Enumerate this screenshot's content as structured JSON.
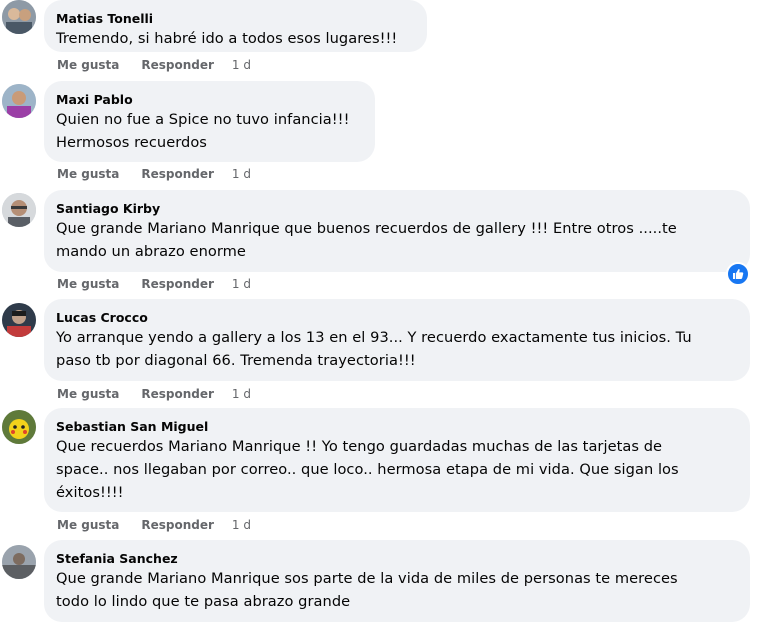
{
  "comments": [
    {
      "author": "Matias Tonelli",
      "text": "Tremendo, si habré ido a todos esos lugares!!!",
      "like": "Me gusta",
      "reply": "Responder",
      "time": "1 d"
    },
    {
      "author": "Maxi Pablo",
      "text": "Quien no fue a Spice no tuvo infancia!!!\nHermosos recuerdos",
      "like": "Me gusta",
      "reply": "Responder",
      "time": "1 d"
    },
    {
      "author": "Santiago Kirby",
      "text": "Que grande Mariano Manrique que buenos recuerdos de gallery !!! Entre otros .....te\nmando un abrazo enorme",
      "like": "Me gusta",
      "reply": "Responder",
      "time": "1 d",
      "reaction_icon": "like-icon"
    },
    {
      "author": "Lucas Crocco",
      "text": "Yo arranque yendo a gallery a los 13 en el 93... Y recuerdo exactamente tus inicios. Tu\npaso tb por diagonal 66. Tremenda trayectoria!!!",
      "like": "Me gusta",
      "reply": "Responder",
      "time": "1 d"
    },
    {
      "author": "Sebastian San Miguel",
      "text": "Que recuerdos Mariano Manrique !! Yo tengo guardadas muchas de las tarjetas de\nspace.. nos llegaban por correo.. que loco.. hermosa etapa de mi vida. Que sigan los\néxitos!!!!",
      "like": "Me gusta",
      "reply": "Responder",
      "time": "1 d"
    },
    {
      "author": "Stefania Sanchez",
      "text": "Que grande Mariano Manrique sos parte de la vida de miles de personas te mereces\ntodo lo lindo que te pasa abrazo grande"
    }
  ],
  "colors": {
    "bubble": "#f0f2f5",
    "meta_text": "#65676b",
    "like_badge": "#1877f2"
  }
}
